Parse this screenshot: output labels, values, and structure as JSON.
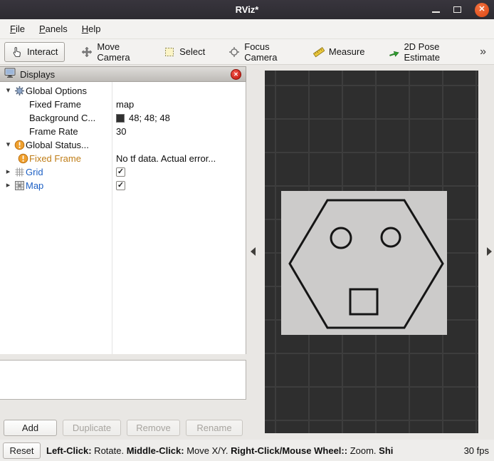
{
  "window": {
    "title": "RViz*"
  },
  "icons": {
    "expand_open": "▾",
    "expand_closed": "▸",
    "check": "✓",
    "overflow": "»",
    "close_x": "✕",
    "panel_close_x": "✕"
  },
  "menubar": {
    "items": [
      {
        "mnemonic": "F",
        "rest": "ile"
      },
      {
        "mnemonic": "P",
        "rest": "anels"
      },
      {
        "mnemonic": "H",
        "rest": "elp"
      }
    ]
  },
  "toolbar": {
    "tools": [
      {
        "label": "Interact",
        "icon": "hand-cursor-icon",
        "active": true
      },
      {
        "label": "Move Camera",
        "icon": "move-arrows-icon",
        "active": false
      },
      {
        "label": "Select",
        "icon": "selection-box-icon",
        "active": false
      },
      {
        "label": "Focus Camera",
        "icon": "focus-crosshair-icon",
        "active": false
      },
      {
        "label": "Measure",
        "icon": "ruler-icon",
        "active": false
      },
      {
        "label": "2D Pose Estimate",
        "icon": "green-pose-arrow-icon",
        "active": false
      }
    ]
  },
  "displays": {
    "title": "Displays",
    "rows": [
      {
        "label": "Global Options",
        "value": "",
        "icon": "global-options-gear-icon"
      },
      {
        "label": "Fixed Frame",
        "value": "map"
      },
      {
        "label": "Background C...",
        "value": "48; 48; 48",
        "swatch": "#303030"
      },
      {
        "label": "Frame Rate",
        "value": "30"
      },
      {
        "label": "Global Status...",
        "value": "",
        "icon": "warning-icon"
      },
      {
        "label": "Fixed Frame",
        "value": "No tf data.  Actual error...",
        "icon": "warning-icon"
      },
      {
        "label": "Grid",
        "value": "",
        "icon": "grid-icon",
        "checked": true
      },
      {
        "label": "Map",
        "value": "",
        "icon": "map-icon",
        "checked": true
      }
    ],
    "buttons": {
      "add": "Add",
      "duplicate": "Duplicate",
      "remove": "Remove",
      "rename": "Rename"
    }
  },
  "statusbar": {
    "reset": "Reset",
    "left_click_label": "Left-Click:",
    "left_click_text": " Rotate. ",
    "middle_click_label": "Middle-Click:",
    "middle_click_text": " Move X/Y. ",
    "right_click_label": "Right-Click/Mouse Wheel::",
    "right_click_text": " Zoom. ",
    "shift_label": "Shi",
    "fps": "30 fps"
  },
  "colors": {
    "titlebar_close": "#dd4814",
    "warning_icon": "#efa02e",
    "status_warn_text": "#bf7d17",
    "display_name_blue": "#1c5fc4",
    "view_background": "#2e2e2e",
    "grid_line": "#3d3d3d",
    "map_free_space": "#cccbca",
    "background_swatch": "#303030"
  }
}
